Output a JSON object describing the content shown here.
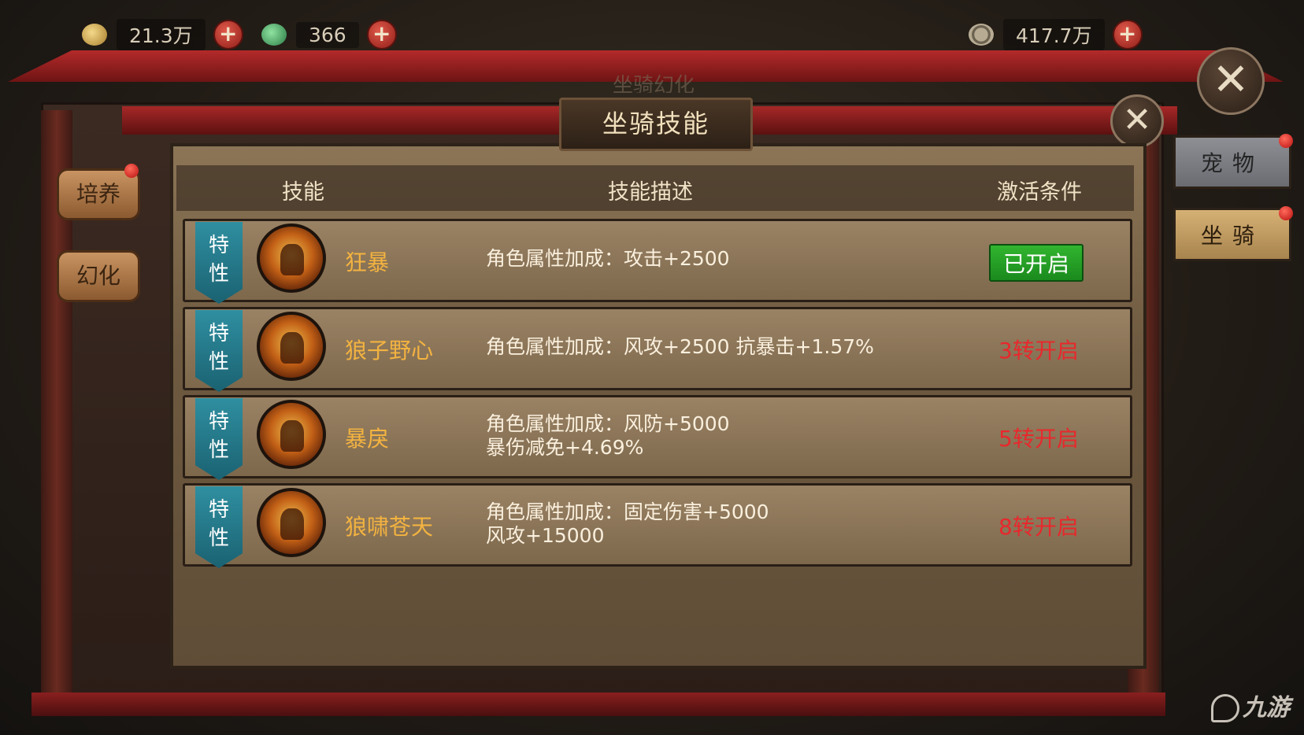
{
  "resources": [
    {
      "name": "gold-ingot",
      "value": "21.3万"
    },
    {
      "name": "jade",
      "value": "366"
    },
    {
      "name": "coin",
      "value": "417.7万"
    }
  ],
  "dialog": {
    "title": "坐骑技能",
    "ghost_title": "坐骑幻化"
  },
  "table": {
    "headers": [
      "技能",
      "技能描述",
      "激活条件"
    ],
    "badge_line1": "特",
    "badge_line2": "性",
    "rows": [
      {
        "name": "狂暴",
        "desc": "角色属性加成：攻击+2500",
        "cond": "已开启",
        "active": true,
        "icon": "roaring-beast-icon"
      },
      {
        "name": "狼子野心",
        "desc": "角色属性加成：风攻+2500 抗暴击+1.57%",
        "cond": "3转开启",
        "active": false,
        "icon": "flame-warrior-icon"
      },
      {
        "name": "暴戾",
        "desc": "角色属性加成：风防+5000\n暴伤减免+4.69%",
        "cond": "5转开启",
        "active": false,
        "icon": "lion-head-icon"
      },
      {
        "name": "狼啸苍天",
        "desc": "角色属性加成：固定伤害+5000\n风攻+15000",
        "cond": "8转开启",
        "active": false,
        "icon": "howling-wolf-icon"
      }
    ]
  },
  "left_menu": [
    "培养",
    "幻化"
  ],
  "right_menu": [
    "宠物",
    "坐骑"
  ],
  "watermark": "九游",
  "colors": {
    "active_green": "#22a323",
    "locked_red": "#e8282c",
    "skill_name": "#f3b340",
    "badge": "#2f8fa0"
  }
}
